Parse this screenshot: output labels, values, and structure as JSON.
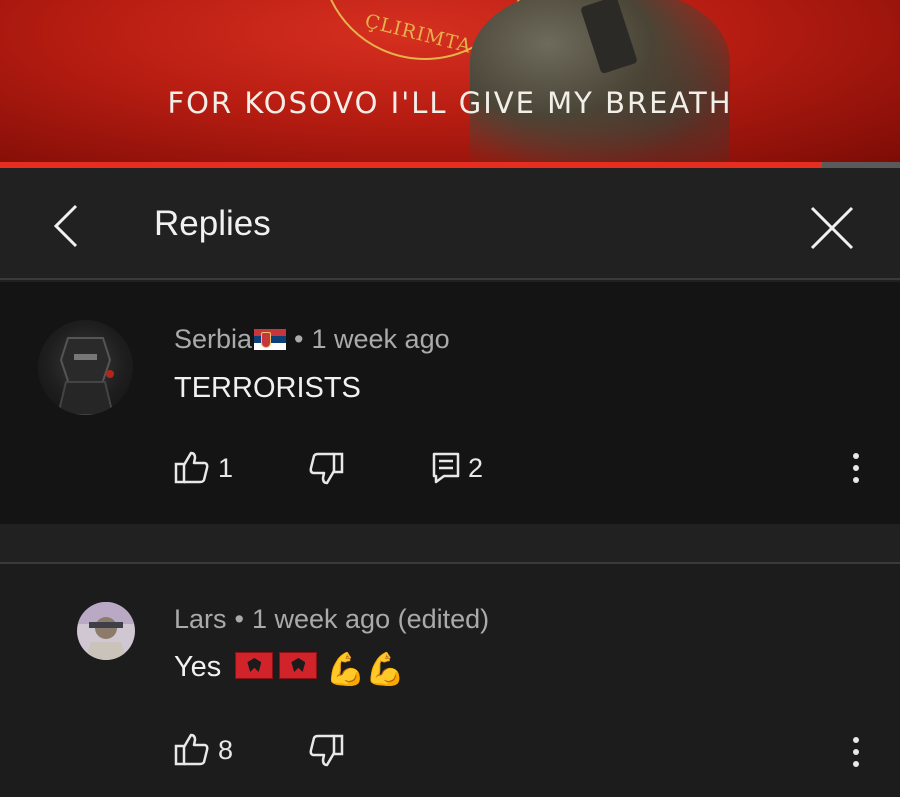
{
  "video": {
    "caption": "FOR KOSOVO I'LL GIVE MY BREATH",
    "emblem_text": "ÇLIRIMTA",
    "progress_fraction": 0.913
  },
  "header": {
    "title": "Replies",
    "back_icon": "chevron-left-icon",
    "close_icon": "close-icon"
  },
  "comments": [
    {
      "author": "Serbia",
      "author_flag": "serbia-flag-emoji",
      "separator": "•",
      "time": "1 week ago",
      "text": "TERRORISTS",
      "likes": "1",
      "replies": "2"
    },
    {
      "author": "Lars",
      "separator": "•",
      "time": "1 week ago (edited)",
      "text": "Yes",
      "emojis": [
        "albania-flag-emoji",
        "albania-flag-emoji",
        "💪",
        "💪"
      ],
      "likes": "8"
    }
  ],
  "colors": {
    "background": "#212121",
    "comment_background": "#141414",
    "accent_red": "#e52d20",
    "meta_text": "#aaaaaa",
    "primary_text": "#f1f1f1"
  }
}
